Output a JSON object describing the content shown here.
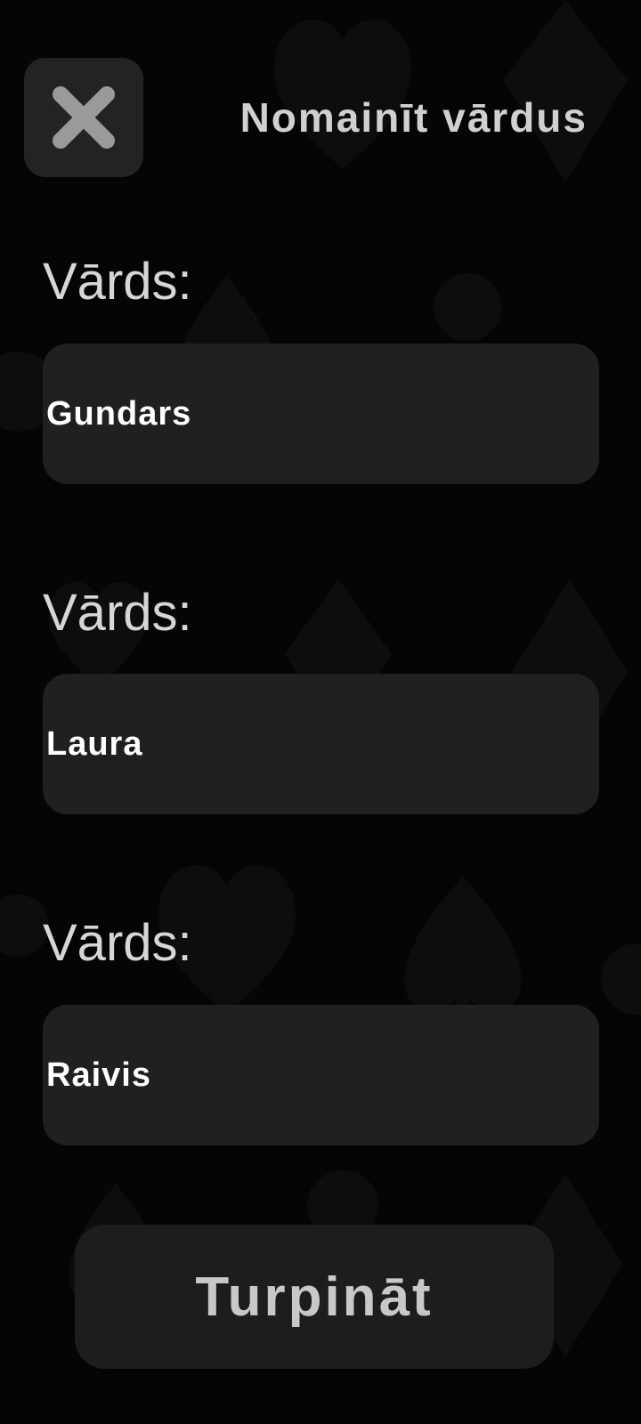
{
  "header": {
    "title": "Nomainīt vārdus",
    "close_icon": "close-x-icon"
  },
  "players": [
    {
      "label": "Vārds:",
      "value": "Gundars"
    },
    {
      "label": "Vārds:",
      "value": "Laura"
    },
    {
      "label": "Vārds:",
      "value": "Raivis"
    }
  ],
  "actions": {
    "continue_label": "Turpināt"
  },
  "colors": {
    "background": "#050505",
    "surface": "#202020",
    "pattern": "#0d0d0d",
    "text_primary": "#ffffff",
    "text_secondary": "#d0d0d0"
  }
}
